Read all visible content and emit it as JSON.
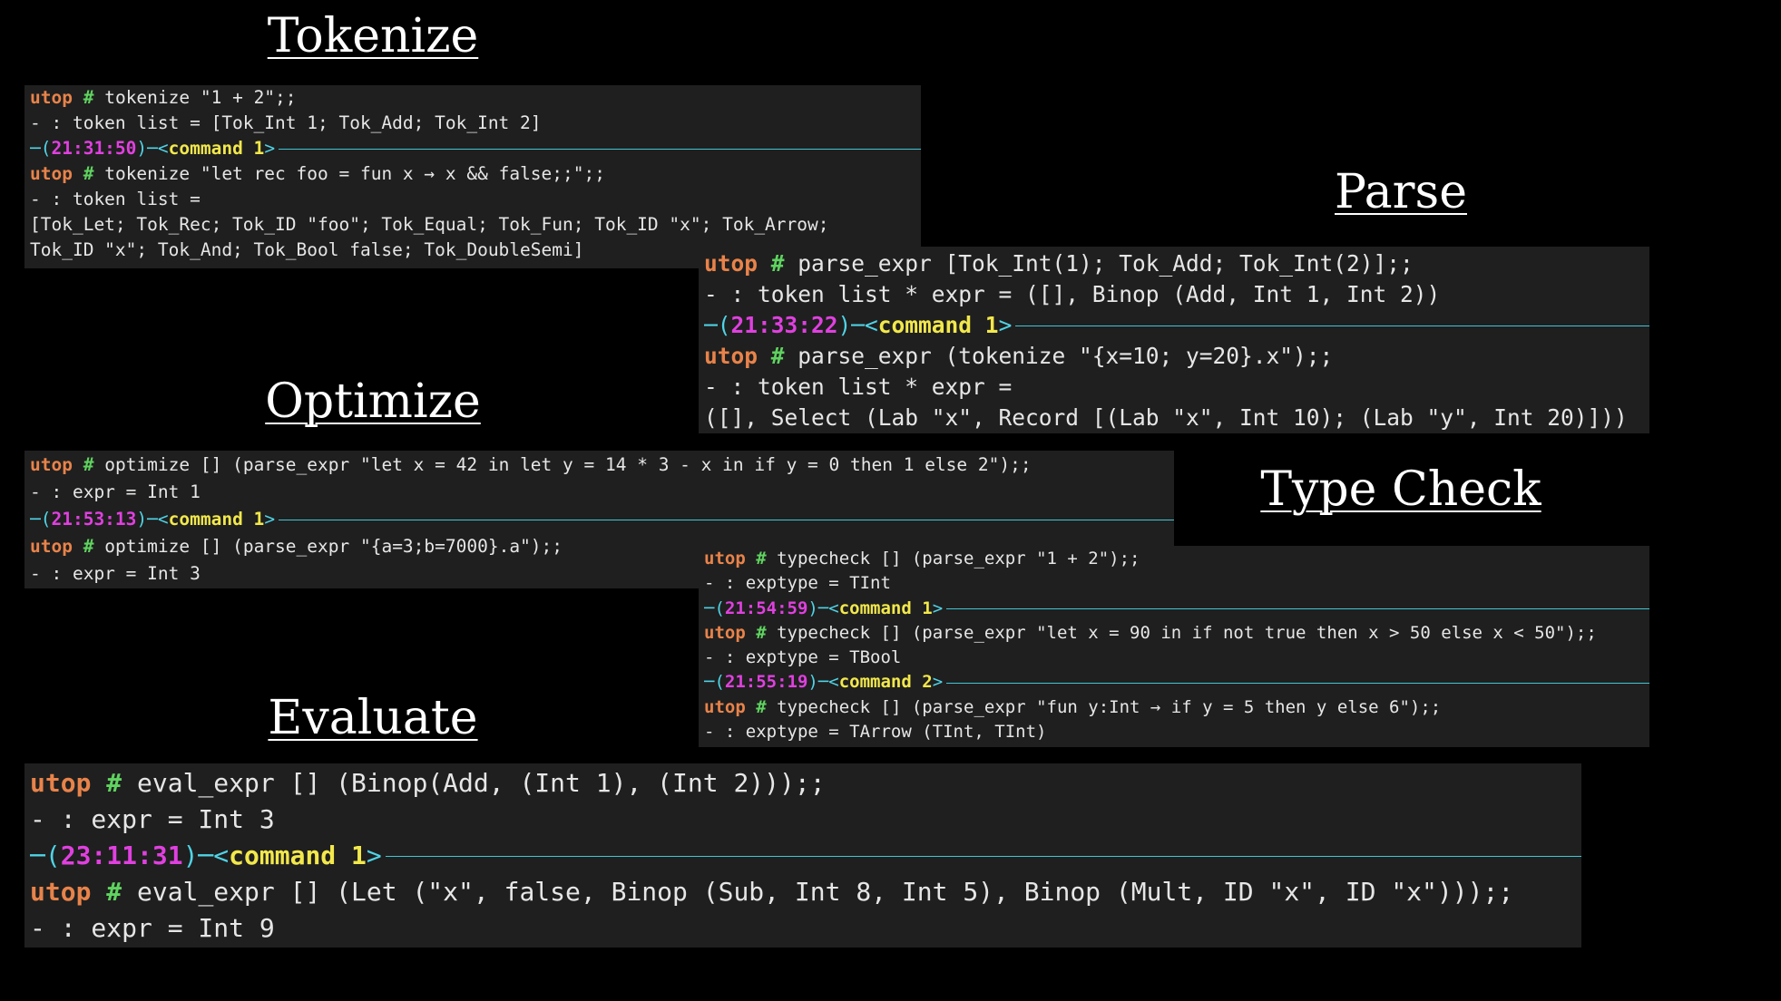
{
  "headings": {
    "tokenize": "Tokenize",
    "parse": "Parse",
    "optimize": "Optimize",
    "typecheck": "Type Check",
    "evaluate": "Evaluate"
  },
  "prompt": {
    "utop": "utop",
    "hash": "#"
  },
  "tokenize": {
    "cmd1": " tokenize \"1 + 2\";;",
    "out1": "- : token list = [Tok_Int 1; Tok_Add; Tok_Int 2]",
    "sep1": {
      "open": "─( ",
      "time": "21:31:50",
      "mid": " )─< ",
      "cmd": "command 1",
      "close": " >"
    },
    "cmd2": " tokenize \"let rec foo = fun x → x && false;;\";;",
    "out2a": "- : token list =",
    "out2b": "[Tok_Let; Tok_Rec; Tok_ID \"foo\"; Tok_Equal; Tok_Fun; Tok_ID \"x\"; Tok_Arrow;",
    "out2c": " Tok_ID \"x\"; Tok_And; Tok_Bool false; Tok_DoubleSemi]"
  },
  "parse": {
    "cmd1": " parse_expr [Tok_Int(1); Tok_Add; Tok_Int(2)];;",
    "out1": "- : token list * expr = ([], Binop (Add, Int 1, Int 2))",
    "sep1": {
      "open": "─( ",
      "time": "21:33:22",
      "mid": " )─< ",
      "cmd": "command 1",
      "close": " >"
    },
    "cmd2": " parse_expr (tokenize \"{x=10; y=20}.x\");;",
    "out2a": "- : token list * expr =",
    "out2b": "([], Select (Lab \"x\", Record [(Lab \"x\", Int 10); (Lab \"y\", Int 20)]))"
  },
  "optimize": {
    "cmd1": " optimize [] (parse_expr \"let x = 42 in let y = 14 * 3 - x in if y = 0 then 1 else 2\");;",
    "out1": "- : expr = Int 1",
    "sep1": {
      "open": "─( ",
      "time": "21:53:13",
      "mid": " )─< ",
      "cmd": "command 1",
      "close": " >"
    },
    "cmd2": " optimize [] (parse_expr \"{a=3;b=7000}.a\");;",
    "out2": "- : expr = Int 3"
  },
  "typecheck": {
    "cmd1": " typecheck [] (parse_expr \"1 + 2\");;",
    "out1": "- : exptype = TInt",
    "sep1": {
      "open": "─( ",
      "time": "21:54:59",
      "mid": " )─< ",
      "cmd": "command 1",
      "close": " >"
    },
    "cmd2": " typecheck [] (parse_expr \"let x = 90 in if not true then x > 50 else x < 50\");;",
    "out2": "- : exptype = TBool",
    "sep2": {
      "open": "─( ",
      "time": "21:55:19",
      "mid": " )─< ",
      "cmd": "command 2",
      "close": " >"
    },
    "cmd3": " typecheck [] (parse_expr \"fun y:Int → if y = 5 then y else 6\");;",
    "out3": "- : exptype = TArrow (TInt, TInt)"
  },
  "evaluate": {
    "cmd1": " eval_expr [] (Binop(Add, (Int 1), (Int 2)));;",
    "out1": "- : expr = Int 3",
    "sep1": {
      "open": "─( ",
      "time": "23:11:31",
      "mid": " )─< ",
      "cmd": "command 1",
      "close": " >"
    },
    "cmd2": " eval_expr [] (Let (\"x\", false, Binop (Sub, Int 8, Int 5), Binop (Mult, ID \"x\", ID \"x\")));;",
    "out2": "- : expr = Int 9"
  },
  "colors": {
    "background": "#000000",
    "panel": "#1f1f1f",
    "utop": "#e8834a",
    "hash": "#5fd35f",
    "time": "#e040e0",
    "command": "#f2e84b",
    "rule": "#3fc6d6"
  }
}
